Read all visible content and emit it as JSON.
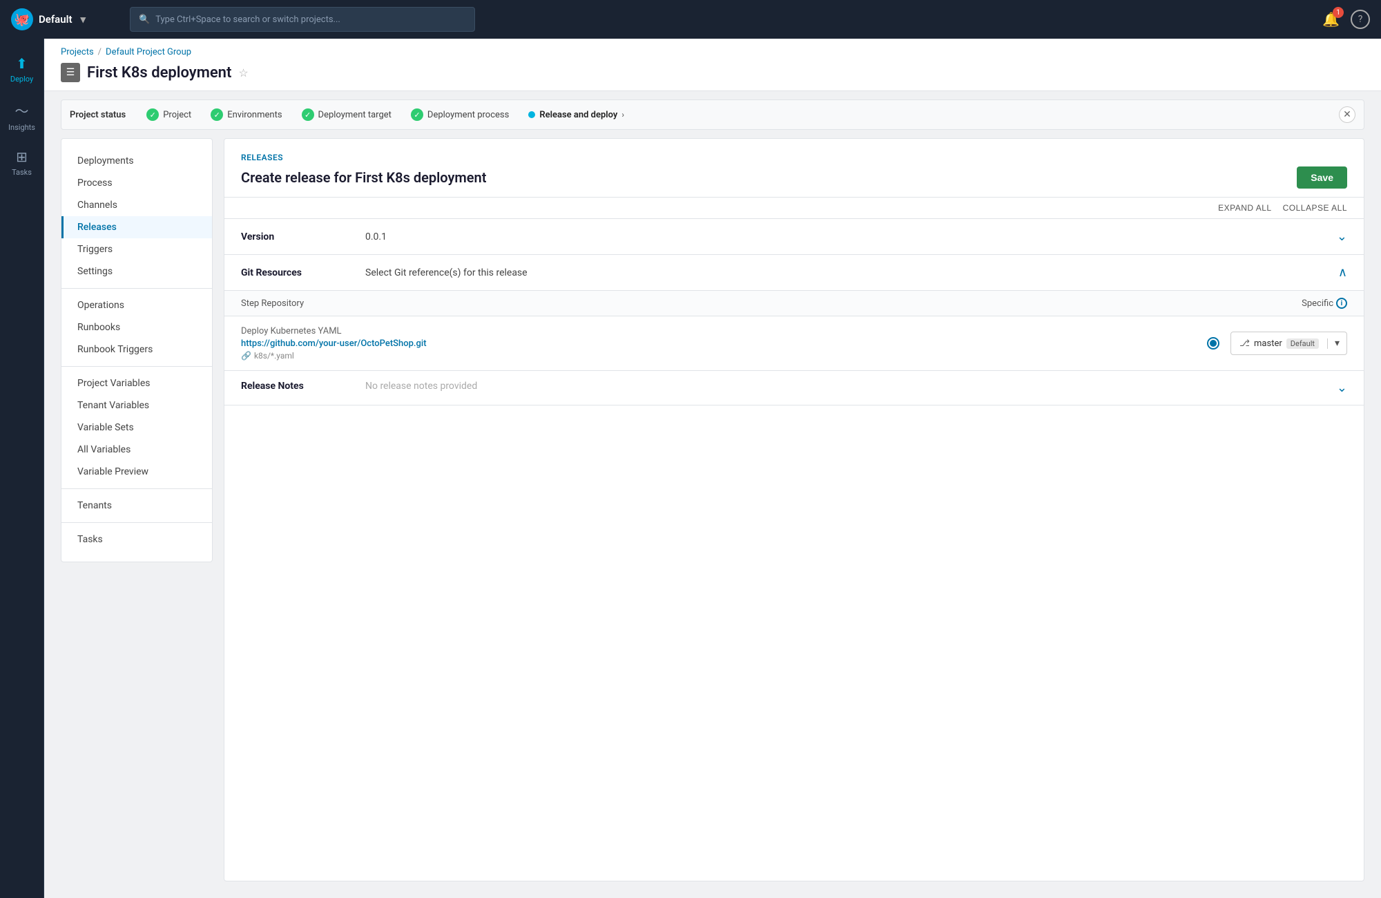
{
  "topnav": {
    "workspace": "Default",
    "search_placeholder": "Type Ctrl+Space to search or switch projects...",
    "notification_count": "1",
    "help_label": "?"
  },
  "sidebar": {
    "items": [
      {
        "id": "deploy",
        "label": "Deploy",
        "icon": "↑",
        "active": true
      },
      {
        "id": "insights",
        "label": "Insights",
        "icon": "∿"
      },
      {
        "id": "tasks",
        "label": "Tasks",
        "icon": "⊞"
      }
    ]
  },
  "breadcrumb": {
    "projects_label": "Projects",
    "separator": "/",
    "group_label": "Default Project Group"
  },
  "page": {
    "title": "First K8s deployment",
    "icon": "≡"
  },
  "status_bar": {
    "label": "Project status",
    "items": [
      {
        "id": "project",
        "label": "Project",
        "status": "complete"
      },
      {
        "id": "environments",
        "label": "Environments",
        "status": "complete"
      },
      {
        "id": "deployment-target",
        "label": "Deployment target",
        "status": "complete"
      },
      {
        "id": "deployment-process",
        "label": "Deployment process",
        "status": "complete"
      },
      {
        "id": "release-deploy",
        "label": "Release and deploy",
        "status": "active"
      }
    ]
  },
  "left_nav": {
    "items": [
      {
        "id": "deployments",
        "label": "Deployments",
        "active": false
      },
      {
        "id": "process",
        "label": "Process",
        "active": false
      },
      {
        "id": "channels",
        "label": "Channels",
        "active": false
      },
      {
        "id": "releases",
        "label": "Releases",
        "active": true
      },
      {
        "id": "triggers",
        "label": "Triggers",
        "active": false
      },
      {
        "id": "settings",
        "label": "Settings",
        "active": false
      },
      {
        "id": "operations",
        "label": "Operations",
        "active": false
      },
      {
        "id": "runbooks",
        "label": "Runbooks",
        "active": false
      },
      {
        "id": "runbook-triggers",
        "label": "Runbook Triggers",
        "active": false
      },
      {
        "id": "project-variables",
        "label": "Project Variables",
        "active": false
      },
      {
        "id": "tenant-variables",
        "label": "Tenant Variables",
        "active": false
      },
      {
        "id": "variable-sets",
        "label": "Variable Sets",
        "active": false
      },
      {
        "id": "all-variables",
        "label": "All Variables",
        "active": false
      },
      {
        "id": "variable-preview",
        "label": "Variable Preview",
        "active": false
      },
      {
        "id": "tenants",
        "label": "Tenants",
        "active": false
      },
      {
        "id": "tasks",
        "label": "Tasks",
        "active": false
      }
    ]
  },
  "releases_section": {
    "section_label": "Releases",
    "title": "Create release for First K8s deployment",
    "save_label": "Save",
    "expand_all": "EXPAND ALL",
    "collapse_all": "COLLAPSE ALL",
    "version_label": "Version",
    "version_value": "0.0.1",
    "git_resources_label": "Git Resources",
    "git_resources_placeholder": "Select Git reference(s) for this release",
    "step_repository_label": "Step Repository",
    "specific_label": "Specific",
    "deploy_step_name": "Deploy Kubernetes YAML",
    "deploy_url": "https://github.com/your-user/OctoPetShop.git",
    "deploy_path": "k8s/*.yaml",
    "branch_name": "master",
    "branch_tag": "Default",
    "release_notes_label": "Release Notes",
    "release_notes_placeholder": "No release notes provided"
  }
}
